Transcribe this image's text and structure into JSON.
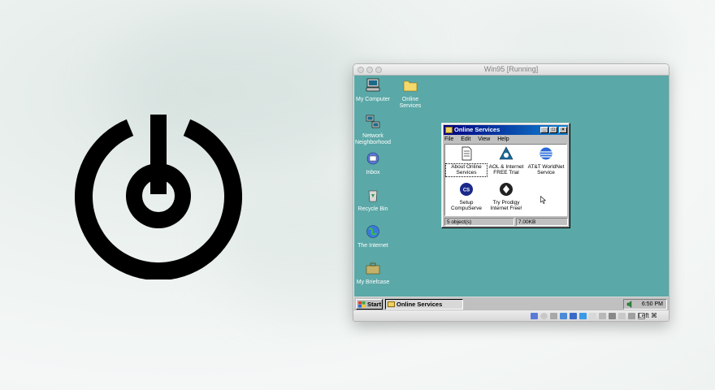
{
  "vm_window": {
    "title": "Win95 [Running]"
  },
  "desktop": {
    "icons": [
      {
        "label": "My Computer",
        "icon": "my-computer-icon"
      },
      {
        "label": "Online Services",
        "icon": "folder-icon"
      },
      {
        "label": "Network Neighborhood",
        "icon": "network-icon"
      },
      {
        "label": "Inbox",
        "icon": "inbox-icon"
      },
      {
        "label": "Recycle Bin",
        "icon": "recycle-bin-icon"
      },
      {
        "label": "The Internet",
        "icon": "internet-icon"
      },
      {
        "label": "My Briefcase",
        "icon": "briefcase-icon"
      }
    ]
  },
  "online_services": {
    "title": "Online Services",
    "menu": [
      "File",
      "Edit",
      "View",
      "Help"
    ],
    "items": [
      {
        "label": "About Online Services",
        "icon": "document-icon"
      },
      {
        "label": "AOL & Internet FREE Trial",
        "icon": "aol-icon"
      },
      {
        "label": "AT&T WorldNet Service",
        "icon": "att-icon"
      },
      {
        "label": "Setup CompuServe",
        "icon": "compuserve-icon"
      },
      {
        "label": "Try Prodigy Internet Free!",
        "icon": "prodigy-icon"
      }
    ],
    "status_objects": "5 object(s)",
    "status_size": "7.00KB"
  },
  "taskbar": {
    "start_label": "Start",
    "active_task": "Online Services",
    "clock": "6:50 PM"
  },
  "vbox_status": {
    "host_key": "Left ⌘"
  },
  "colors": {
    "desktop": "#5aa8a7",
    "title_bar": "#000080",
    "window_face": "#c0c0c0"
  }
}
